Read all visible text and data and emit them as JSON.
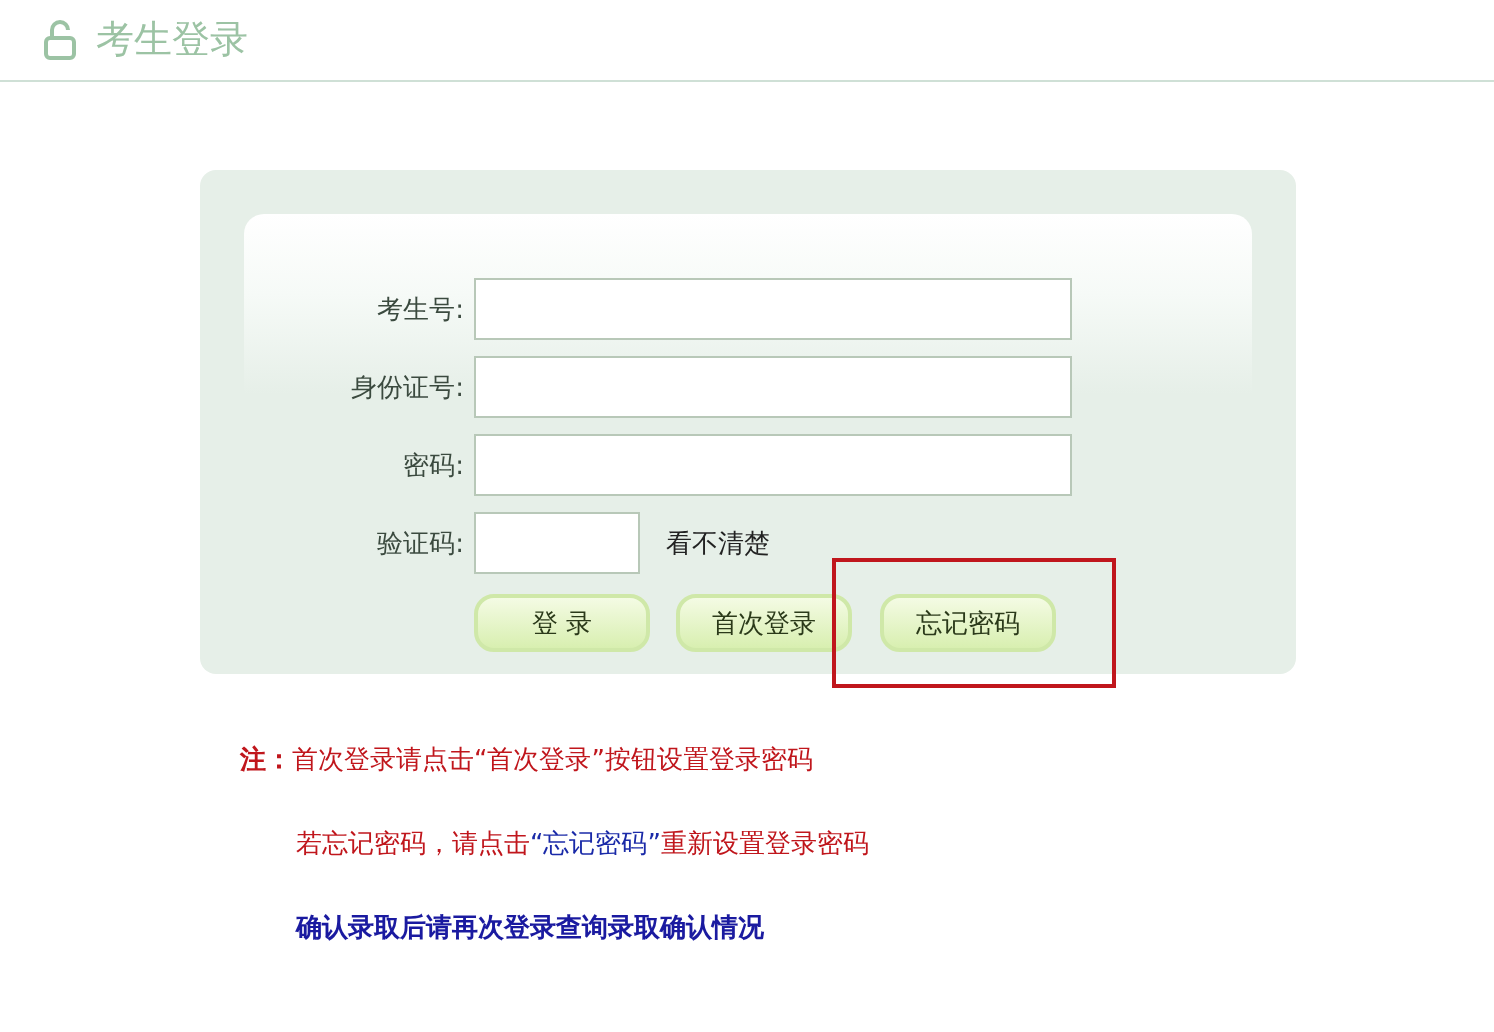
{
  "header": {
    "title": "考生登录"
  },
  "form": {
    "fields": [
      {
        "label": "考生号:",
        "kind": "text"
      },
      {
        "label": "身份证号:",
        "kind": "text"
      },
      {
        "label": "密码:",
        "kind": "password"
      },
      {
        "label": "验证码:",
        "kind": "captcha",
        "link": "看不清楚"
      }
    ],
    "buttons": [
      {
        "label": "登 录",
        "highlighted": false
      },
      {
        "label": "首次登录",
        "highlighted": false
      },
      {
        "label": "忘记密码",
        "highlighted": true
      }
    ]
  },
  "notes": [
    {
      "kind": "warning",
      "text": "**注：**首次登录请点击“首次登录”按钮设置登录密码"
    },
    {
      "kind": "mixed",
      "before": "若忘记密码，请点击",
      "highlight": "“忘记密码”",
      "after": "重新设置登录密码"
    },
    {
      "kind": "emphasis",
      "text": "确认录取后请再次登录查询录取确认情况"
    }
  ]
}
